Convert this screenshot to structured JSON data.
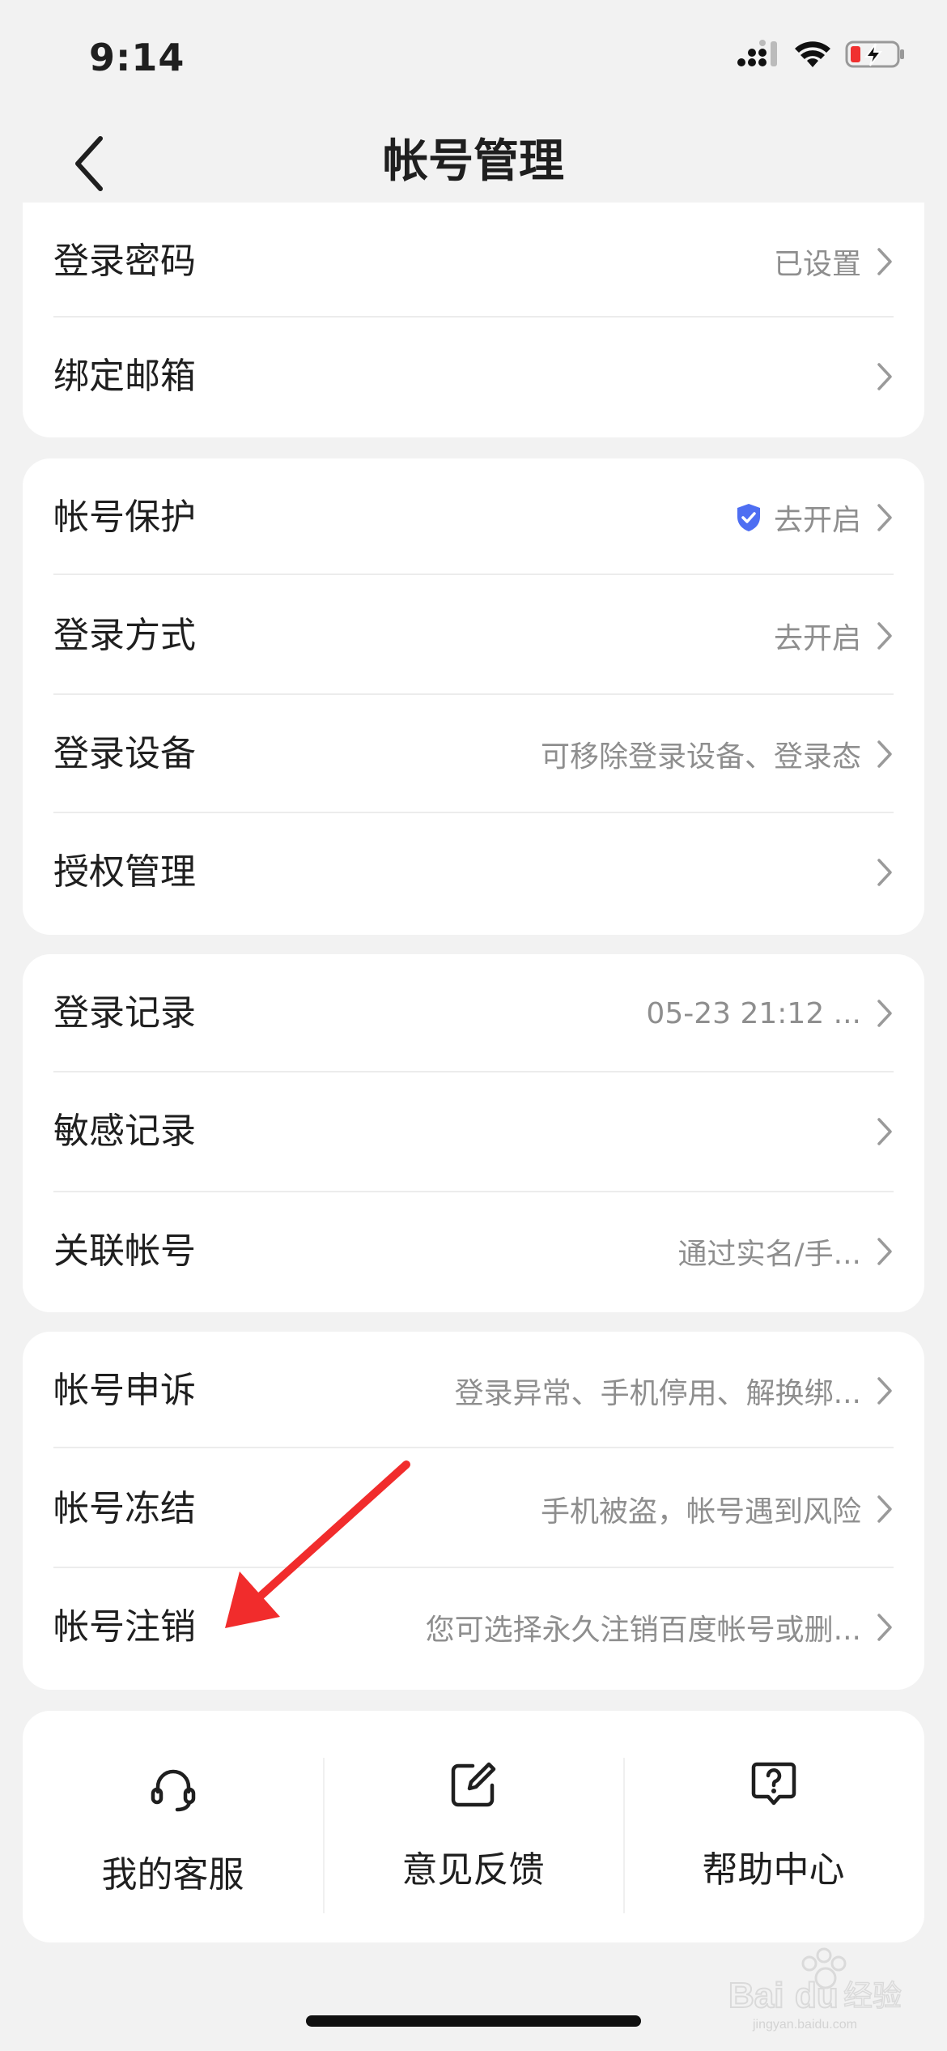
{
  "status_bar": {
    "time": "9:14"
  },
  "header": {
    "title": "帐号管理"
  },
  "groups": [
    {
      "rows": [
        {
          "label": "登录密码",
          "value": "已设置"
        },
        {
          "label": "绑定邮箱",
          "value": ""
        }
      ]
    },
    {
      "rows": [
        {
          "label": "帐号保护",
          "value": "去开启",
          "icon": "shield-check-icon"
        },
        {
          "label": "登录方式",
          "value": "去开启"
        },
        {
          "label": "登录设备",
          "value": "可移除登录设备、登录态"
        },
        {
          "label": "授权管理",
          "value": ""
        }
      ]
    },
    {
      "rows": [
        {
          "label": "登录记录",
          "value": "05-23 21:12 ..."
        },
        {
          "label": "敏感记录",
          "value": ""
        },
        {
          "label": "关联帐号",
          "value": "通过实名/手..."
        }
      ]
    },
    {
      "rows": [
        {
          "label": "帐号申诉",
          "value": "登录异常、手机停用、解换绑..."
        },
        {
          "label": "帐号冻结",
          "value": "手机被盗，帐号遇到风险"
        },
        {
          "label": "帐号注销",
          "value": "您可选择永久注销百度帐号或删..."
        }
      ]
    }
  ],
  "quick_actions": [
    {
      "label": "我的客服",
      "icon": "headset-icon"
    },
    {
      "label": "意见反馈",
      "icon": "edit-icon"
    },
    {
      "label": "帮助中心",
      "icon": "help-icon"
    }
  ],
  "colors": {
    "background": "#f2f2f2",
    "card": "#ffffff",
    "shield": "#4e6ef2",
    "annotation_arrow": "#f12c2c",
    "battery_low": "#f0302f"
  },
  "watermark": {
    "text": "Baidu经验",
    "sub": "jingyan.baidu.com"
  }
}
